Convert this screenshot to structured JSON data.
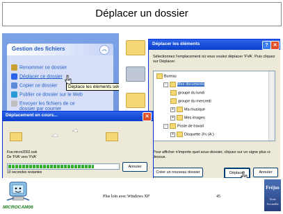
{
  "slide": {
    "title": "Déplacer un dossier",
    "footer_left": "Plus loin avec Windows XP",
    "page_number": "45",
    "logo_left_label": "MICROCAM06",
    "logo_right_top": "Fréjus",
    "logo_right_bottom1": "Vous",
    "logo_right_bottom2": "Accueille"
  },
  "task_panel": {
    "heading": "Gestion des fichiers",
    "items": [
      {
        "label": "Renommer ce dossier",
        "icon": "rename-icon",
        "color": "#c8a030"
      },
      {
        "label": "Déplacer ce dossier",
        "icon": "move-icon",
        "color": "#2a64e8"
      },
      {
        "label": "Copier ce dossier",
        "icon": "copy-icon",
        "color": "#5a8ad8"
      },
      {
        "label": "Publier ce dossier sur le Web",
        "icon": "publish-icon",
        "color": "#2a9ad8"
      },
      {
        "label": "Envoyer les fichiers de ce",
        "icon": "email-icon",
        "color": "#c0c0c0"
      },
      {
        "label": "dossier par courrier",
        "icon": "",
        "color": ""
      }
    ],
    "tooltip": "Déplace les éléments sélectionnés"
  },
  "move_dialog": {
    "title": "Déplacer les éléments",
    "instruction": "Sélectionnez l'emplacement où vous voulez déplacer 'FVA'. Puis cliquez sur Déplacer.",
    "tree": [
      {
        "label": "Bureau",
        "level": 0,
        "sign": "",
        "selected": false
      },
      {
        "label": "Mes documents",
        "level": 1,
        "sign": "-",
        "selected": true
      },
      {
        "label": "groupe du lundi",
        "level": 2,
        "sign": "",
        "selected": false
      },
      {
        "label": "groupe du mercredi",
        "level": 2,
        "sign": "",
        "selected": false
      },
      {
        "label": "Ma musique",
        "level": 2,
        "sign": "+",
        "selected": false
      },
      {
        "label": "Mes images",
        "level": 2,
        "sign": "+",
        "selected": false
      },
      {
        "label": "Poste de travail",
        "level": 1,
        "sign": "-",
        "selected": false
      },
      {
        "label": "Disquette 3½ (A:)",
        "level": 2,
        "sign": "+",
        "selected": false
      }
    ],
    "hint": "Pour afficher n'importe quel sous-dossier, cliquez sur un signe plus ci-dessus.",
    "new_folder_button": "Créer un nouveau dossier",
    "move_button": "Déplacer",
    "cancel_button": "Annuler"
  },
  "progress_dialog": {
    "title": "Déplacement en cours...",
    "filename": "Fva-micro2002.cwk",
    "from_to": "De 'FVA' vers 'FVA'",
    "remaining": "10 secondes restantes",
    "progress": 0.78,
    "cancel_button": "Annuler"
  },
  "colors": {
    "xp_blue": "#0a3fcb",
    "progress_green": "#2fb12f",
    "folder_yellow": "#f5d876"
  }
}
